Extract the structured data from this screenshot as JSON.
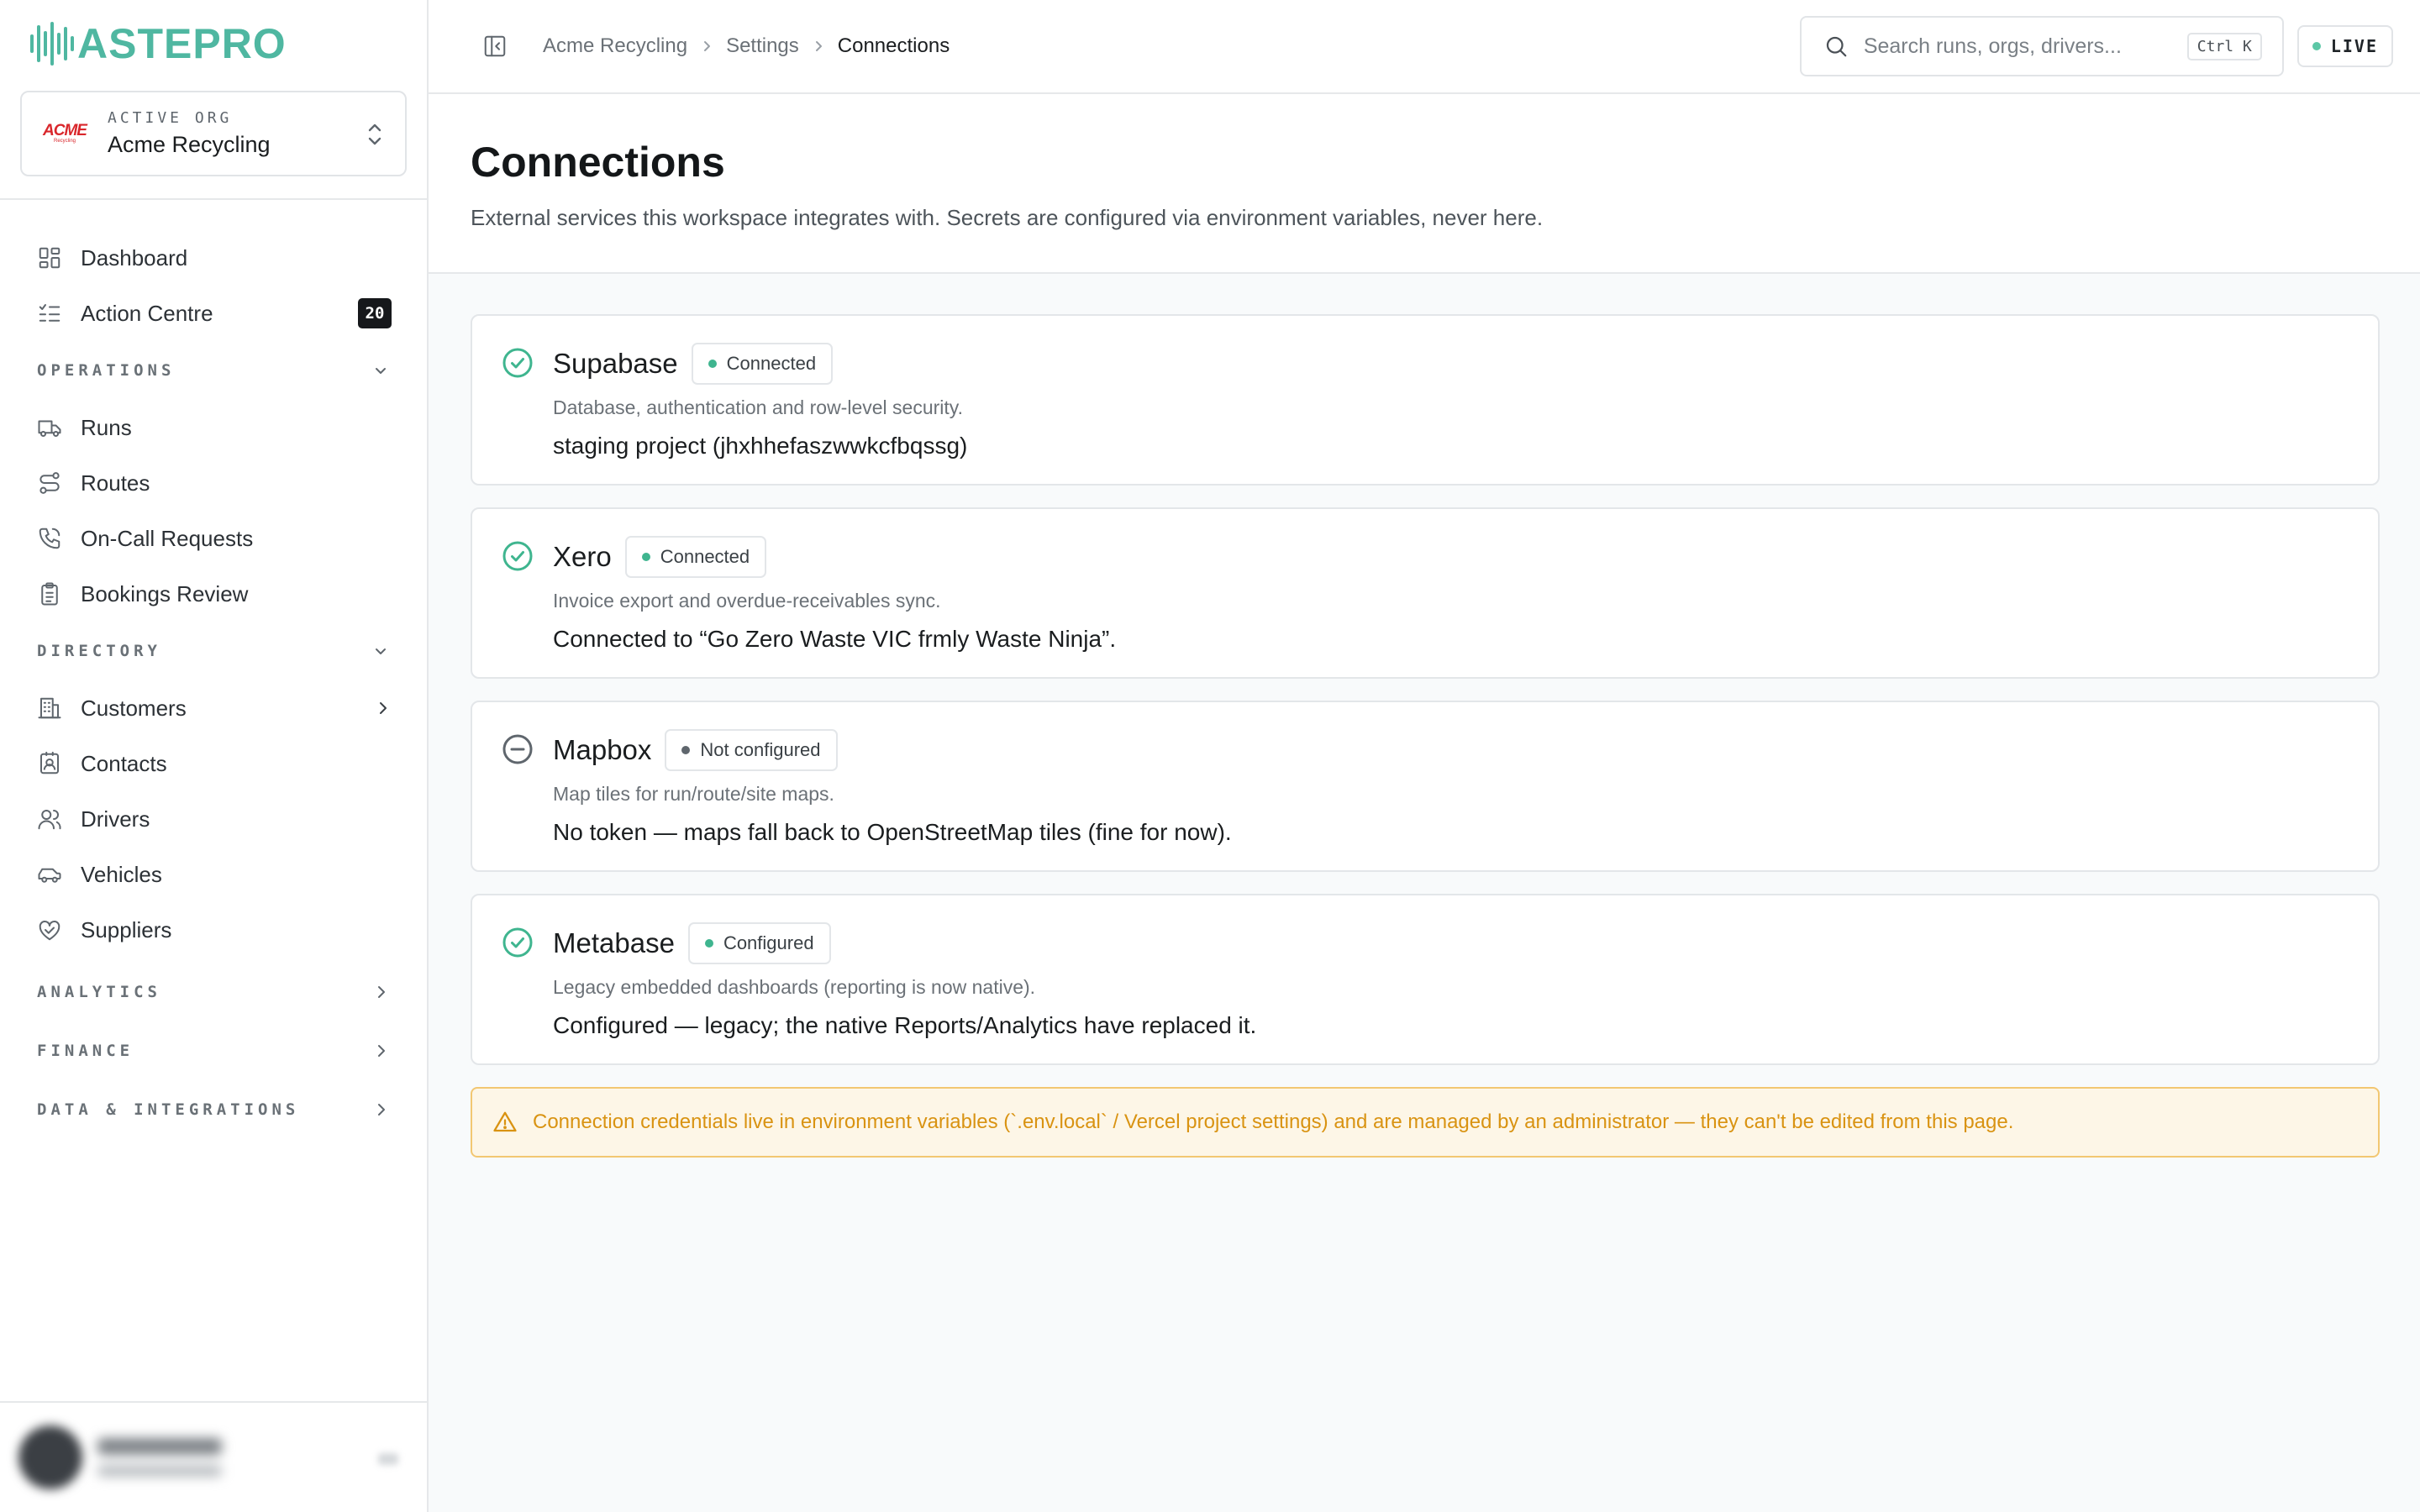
{
  "brand": {
    "logo_text": "ASTEPRO"
  },
  "org": {
    "label": "ACTIVE ORG",
    "name": "Acme Recycling",
    "logo_text": "ACME",
    "logo_subtext": "Recycling",
    "logo_color": "#d9262b"
  },
  "sidebar": {
    "top_items": [
      {
        "label": "Dashboard",
        "icon": "dashboard-grid-icon"
      },
      {
        "label": "Action Centre",
        "icon": "checklist-icon",
        "badge": "20"
      }
    ],
    "sections": {
      "operations": {
        "label": "OPERATIONS",
        "expanded": true,
        "items": [
          {
            "label": "Runs",
            "icon": "truck-icon"
          },
          {
            "label": "Routes",
            "icon": "route-icon"
          },
          {
            "label": "On-Call Requests",
            "icon": "phone-icon"
          },
          {
            "label": "Bookings Review",
            "icon": "clipboard-icon"
          }
        ]
      },
      "directory": {
        "label": "DIRECTORY",
        "expanded": true,
        "items": [
          {
            "label": "Customers",
            "icon": "building-icon",
            "has_children": true
          },
          {
            "label": "Contacts",
            "icon": "contact-card-icon"
          },
          {
            "label": "Drivers",
            "icon": "users-icon"
          },
          {
            "label": "Vehicles",
            "icon": "car-icon"
          },
          {
            "label": "Suppliers",
            "icon": "handshake-icon"
          }
        ]
      },
      "analytics": {
        "label": "ANALYTICS",
        "expanded": false
      },
      "finance": {
        "label": "FINANCE",
        "expanded": false
      },
      "data_integrations": {
        "label": "DATA & INTEGRATIONS",
        "expanded": false
      }
    }
  },
  "topbar": {
    "breadcrumb": [
      "Acme Recycling",
      "Settings",
      "Connections"
    ],
    "search_placeholder": "Search runs, orgs, drivers...",
    "search_shortcut": "Ctrl K",
    "live_label": "LIVE"
  },
  "page": {
    "title": "Connections",
    "subtitle": "External services this workspace integrates with. Secrets are configured via environment variables, never here."
  },
  "connections": [
    {
      "name": "Supabase",
      "status": "Connected",
      "state": "ok",
      "description": "Database, authentication and row-level security.",
      "detail": "staging project (jhxhhefaszwwkcfbqssg)"
    },
    {
      "name": "Xero",
      "status": "Connected",
      "state": "ok",
      "description": "Invoice export and overdue-receivables sync.",
      "detail": "Connected to “Go Zero Waste VIC frmly Waste Ninja”."
    },
    {
      "name": "Mapbox",
      "status": "Not configured",
      "state": "off",
      "description": "Map tiles for run/route/site maps.",
      "detail": "No token — maps fall back to OpenStreetMap tiles (fine for now)."
    },
    {
      "name": "Metabase",
      "status": "Configured",
      "state": "ok",
      "description": "Legacy embedded dashboards (reporting is now native).",
      "detail": "Configured — legacy; the native Reports/Analytics have replaced it."
    }
  ],
  "notice": {
    "text": "Connection credentials live in environment variables (`.env.local` / Vercel project settings) and are managed by an administrator — they can't be edited from this page."
  },
  "colors": {
    "brand": "#4fb7a1",
    "status_ok": "#3fb58f",
    "status_off": "#5f666d",
    "warning_text": "#d99312",
    "warning_bg": "#fdf6e7",
    "warning_border": "#f2c772"
  }
}
